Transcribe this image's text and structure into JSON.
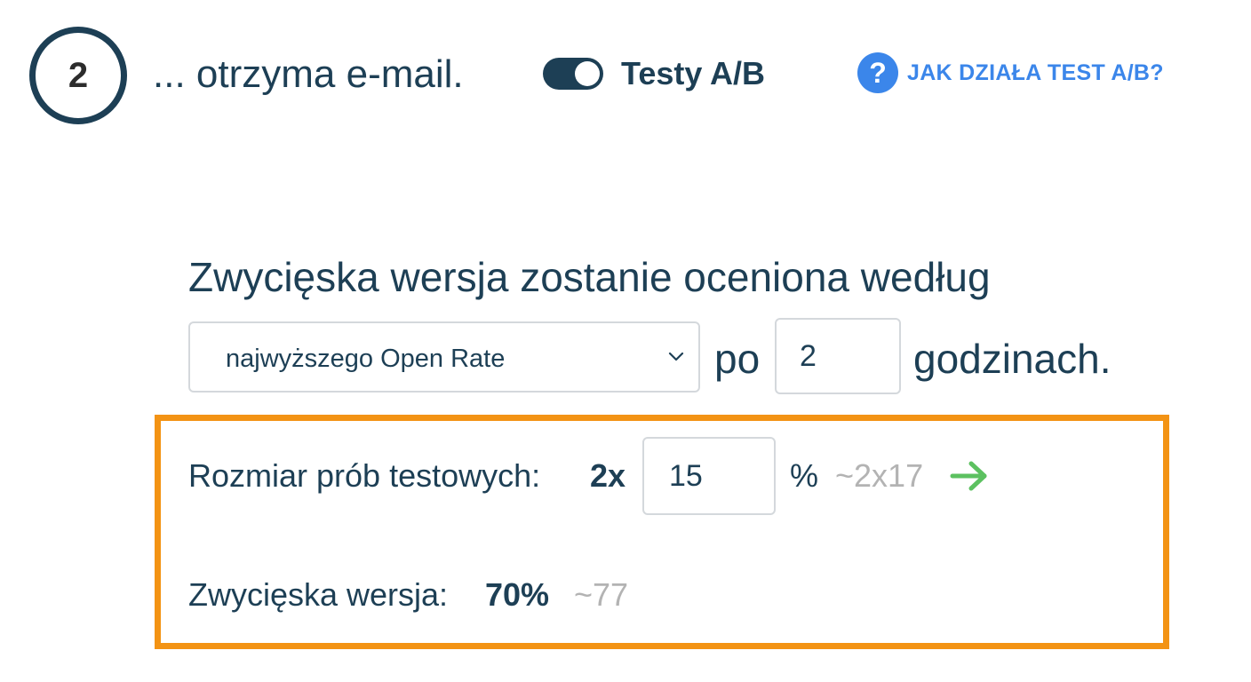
{
  "step": {
    "number": "2",
    "title": "... otrzyma e-mail."
  },
  "ab_toggle": {
    "label": "Testy A/B",
    "enabled": true
  },
  "help": {
    "icon": "question-circle-icon",
    "label": "JAK DZIAŁA TEST A/B?"
  },
  "rule": {
    "heading": "Zwycięska wersja zostanie oceniona według",
    "metric_selected": "najwyższego Open Rate",
    "po_label": "po",
    "hours_value": "2",
    "hours_suffix": "godzinach."
  },
  "sample": {
    "label": "Rozmiar prób testowych:",
    "multiplier": "2x",
    "percent_value": "15",
    "percent_sign": "%",
    "estimate": "~2x17",
    "arrow_icon": "arrow-right-icon"
  },
  "winner": {
    "label": "Zwycięska wersja:",
    "percent": "70%",
    "estimate": "~77"
  },
  "colors": {
    "primary": "#1d3f55",
    "link": "#3b86ea",
    "highlight_border": "#f39314",
    "muted": "#b3b3b3",
    "arrow": "#5cc160"
  }
}
